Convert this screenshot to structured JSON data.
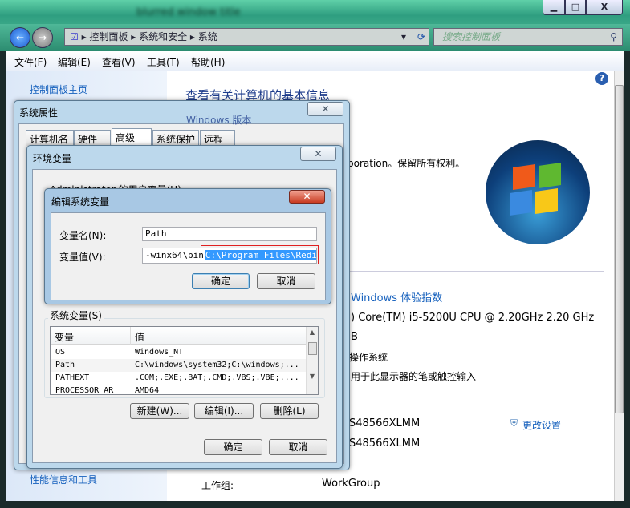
{
  "window": {
    "title": "blurred window title",
    "minimize": "▁",
    "maximize": "□",
    "close": "X"
  },
  "address": {
    "crumbs": [
      "控制面板",
      "系统和安全",
      "系统"
    ],
    "search_placeholder": "搜索控制面板"
  },
  "menu": [
    "文件(F)",
    "编辑(E)",
    "查看(V)",
    "工具(T)",
    "帮助(H)"
  ],
  "left": {
    "home": "控制面板主页",
    "perf": "性能信息和工具"
  },
  "main": {
    "title": "查看有关计算机的基本信息",
    "edition_header": "Windows 版本",
    "copyright": "poration。保留所有权利。",
    "wei_link": "Windows 体验指数",
    "cpu": ") Core(TM) i5-5200U CPU @ 2.20GHz   2.20 GHz",
    "ram": "B",
    "os_type": "操作系统",
    "pen": "用于此显示器的笔或触控输入",
    "computer_name": "S48566XLMM",
    "full_name": "S48566XLMM",
    "change_settings": "更改设置",
    "workgroup_label": "工作组:",
    "workgroup": "WorkGroup"
  },
  "sysprops": {
    "title": "系统属性",
    "tabs": [
      "计算机名",
      "硬件",
      "高级",
      "系统保护",
      "远程"
    ],
    "active_tab": "高级"
  },
  "envvars": {
    "title": "环境变量",
    "user_vars_label": "Administrator 的用户变量(U)",
    "sys_vars_label": "系统变量(S)",
    "columns": [
      "变量",
      "值"
    ],
    "rows": [
      [
        "OS",
        "Windows_NT"
      ],
      [
        "Path",
        "C:\\windows\\system32;C:\\windows;..."
      ],
      [
        "PATHEXT",
        ".COM;.EXE;.BAT;.CMD;.VBS;.VBE;...."
      ],
      [
        "PROCESSOR_AR",
        "AMD64"
      ]
    ],
    "new_btn": "新建(W)...",
    "edit_btn": "编辑(I)...",
    "delete_btn": "删除(L)",
    "ok": "确定",
    "cancel": "取消"
  },
  "editvar": {
    "title": "编辑系统变量",
    "name_label": "变量名(N):",
    "name_value": "Path",
    "value_label": "变量值(V):",
    "value_prefix": "-winx64\\bin",
    "value_selected": "C:\\Program Files\\Redis\\",
    "ok": "确定",
    "cancel": "取消",
    "highlight_color": "#e02020"
  }
}
